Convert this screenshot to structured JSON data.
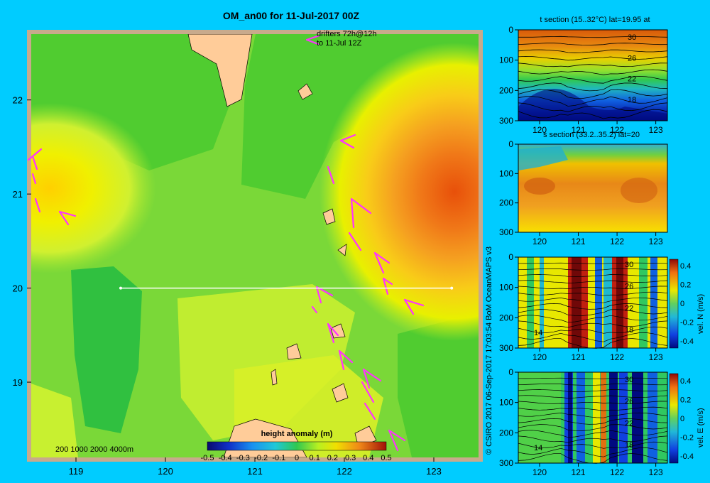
{
  "title": "OM_an00 for 11-Jul-2017 00Z",
  "credit": "© CSIRO 2017   06-Sep-2017 17:03:54 BoM OceanMAPS v3",
  "drifters_note": [
    "drifters 72h@12h",
    "to 11-Jul 12Z"
  ],
  "depth_scale_label": "200  1000  2000  4000m",
  "colors": {
    "background": "#00ccff",
    "arrows": "#ff33ff",
    "land": "#ffcc99",
    "shelf": "#c8aa8c"
  },
  "chart_data": [
    {
      "type": "heatmap",
      "name": "map",
      "x_ticks": [
        "119",
        "120",
        "121",
        "122",
        "123"
      ],
      "x_tick_values": [
        119,
        120,
        121,
        122,
        123
      ],
      "y_ticks": [
        "22",
        "21",
        "20",
        "19"
      ],
      "y_tick_values": [
        22,
        21,
        20,
        19
      ],
      "xlim": [
        118.5,
        123.5
      ],
      "ylim": [
        18.2,
        22.7
      ],
      "section_line": {
        "lon": [
          119.5,
          123.2
        ],
        "lat": [
          20,
          20
        ]
      },
      "colorbar": {
        "title": "height anomaly  (m)",
        "ticks": [
          "-0.5",
          "-0.4",
          "-0.3",
          "-0.2",
          "-0.1",
          "0",
          "0.1",
          "0.2",
          "0.3",
          "0.4",
          "0.5"
        ],
        "range": [
          -0.5,
          0.5
        ]
      }
    },
    {
      "type": "heatmap",
      "name": "t-section",
      "title": "t section (15..32°C) lat=19.95 at",
      "x_ticks": [
        "120",
        "121",
        "122",
        "123"
      ],
      "y_ticks": [
        "0",
        "100",
        "200",
        "300"
      ],
      "contour_labels": [
        "30",
        "26",
        "22",
        "18"
      ]
    },
    {
      "type": "heatmap",
      "name": "s-section",
      "title": "s section (33.2..35.2) lat=20",
      "x_ticks": [
        "120",
        "121",
        "122",
        "123"
      ],
      "y_ticks": [
        "0",
        "100",
        "200",
        "300"
      ]
    },
    {
      "type": "heatmap",
      "name": "vn-section",
      "x_ticks": [
        "120",
        "121",
        "122",
        "123"
      ],
      "y_ticks": [
        "0",
        "100",
        "200",
        "300"
      ],
      "contour_labels": [
        "30",
        "26",
        "22",
        "18",
        "14"
      ],
      "colorbar": {
        "label": "vel. N  (m/s)",
        "ticks": [
          "0.4",
          "0.2",
          "0",
          "-0.2",
          "-0.4"
        ],
        "range": [
          -0.4,
          0.4
        ]
      }
    },
    {
      "type": "heatmap",
      "name": "ve-section",
      "x_ticks": [
        "120",
        "121",
        "122",
        "123"
      ],
      "y_ticks": [
        "0",
        "100",
        "200",
        "300"
      ],
      "contour_labels": [
        "30",
        "26",
        "22",
        "18",
        "14"
      ],
      "colorbar": {
        "label": "vel. E  (m/s)",
        "ticks": [
          "0.4",
          "0.2",
          "0",
          "-0.2",
          "-0.4"
        ],
        "range": [
          -0.4,
          0.4
        ]
      }
    }
  ]
}
